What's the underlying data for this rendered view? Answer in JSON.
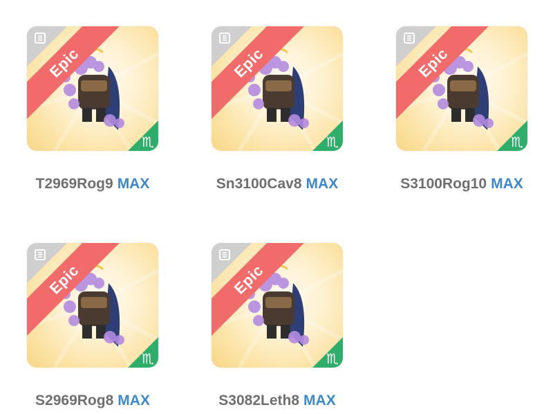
{
  "colors": {
    "epic_ribbon": "#f26b6b",
    "zodiac_corner": "#2fae6b",
    "max_text": "#3d88c8",
    "name_text": "#6f6f6f"
  },
  "items": [
    {
      "name": "T2969Rog9",
      "level": "MAX",
      "rarity": "Epic",
      "zodiac_icon": "scorpio-icon",
      "zodiac_glyph": "♏"
    },
    {
      "name": "Sn3100Cav8",
      "level": "MAX",
      "rarity": "Epic",
      "zodiac_icon": "scorpio-icon",
      "zodiac_glyph": "♏"
    },
    {
      "name": "S3100Rog10",
      "level": "MAX",
      "rarity": "Epic",
      "zodiac_icon": "scorpio-icon",
      "zodiac_glyph": "♏"
    },
    {
      "name": "S2969Rog8",
      "level": "MAX",
      "rarity": "Epic",
      "zodiac_icon": "scorpio-icon",
      "zodiac_glyph": "♏"
    },
    {
      "name": "S3082Leth8",
      "level": "MAX",
      "rarity": "Epic",
      "zodiac_icon": "scorpio-icon",
      "zodiac_glyph": "♏"
    }
  ]
}
